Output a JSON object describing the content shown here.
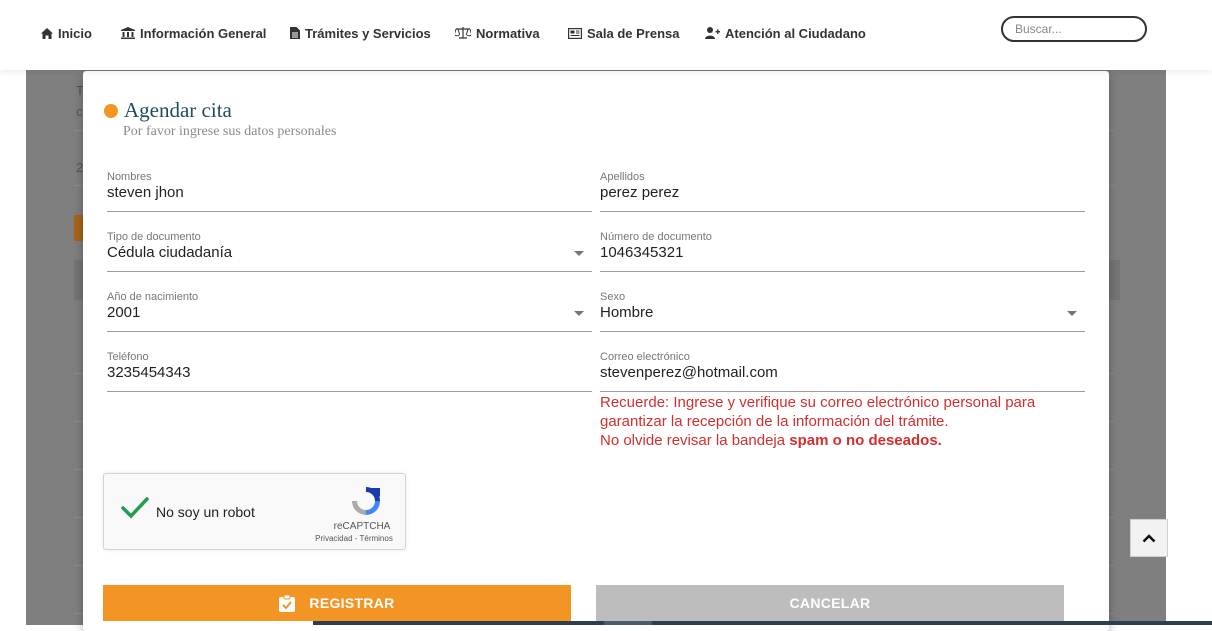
{
  "nav": {
    "items": [
      {
        "label": "Inicio",
        "icon": "home-icon"
      },
      {
        "label": "Información General",
        "icon": "institution-icon"
      },
      {
        "label": "Trámites y Servicios",
        "icon": "document-icon"
      },
      {
        "label": "Normativa",
        "icon": "scales-icon"
      },
      {
        "label": "Sala de Prensa",
        "icon": "newspaper-icon"
      },
      {
        "label": "Atención al Ciudadano",
        "icon": "user-plus-icon"
      }
    ],
    "search_placeholder": "Buscar..."
  },
  "background": {
    "fragments": [
      "T",
      "c",
      "2"
    ]
  },
  "modal": {
    "title": "Agendar cita",
    "subtitle": "Por favor ingrese sus datos personales",
    "fields": {
      "nombres": {
        "label": "Nombres",
        "value": "steven jhon"
      },
      "apellidos": {
        "label": "Apellidos",
        "value": "perez perez"
      },
      "tipo_documento": {
        "label": "Tipo de documento",
        "value": "Cédula ciudadanía"
      },
      "numero_documento": {
        "label": "Número de documento",
        "value": "1046345321"
      },
      "anio_nacimiento": {
        "label": "Año de nacimiento",
        "value": "2001"
      },
      "sexo": {
        "label": "Sexo",
        "value": "Hombre"
      },
      "telefono": {
        "label": "Teléfono",
        "value": "3235454343"
      },
      "correo": {
        "label": "Correo electrónico",
        "value": "stevenperez@hotmail.com"
      }
    },
    "warning": {
      "line1": "Recuerde: Ingrese y verifique su correo electrónico personal para garantizar la recepción de la información del trámite.",
      "line2_prefix": "No olvide revisar la bandeja ",
      "line2_bold": "spam o no deseados."
    },
    "captcha": {
      "label": "No soy un robot",
      "brand": "reCAPTCHA",
      "links": "Privacidad - Términos"
    },
    "buttons": {
      "register": "REGISTRAR",
      "cancel": "CANCELAR"
    }
  },
  "colors": {
    "accent": "#f39525",
    "title": "#1e4e5c",
    "warning": "#d32f2f",
    "cancel": "#bdbdbd",
    "check": "#1e9e50"
  }
}
